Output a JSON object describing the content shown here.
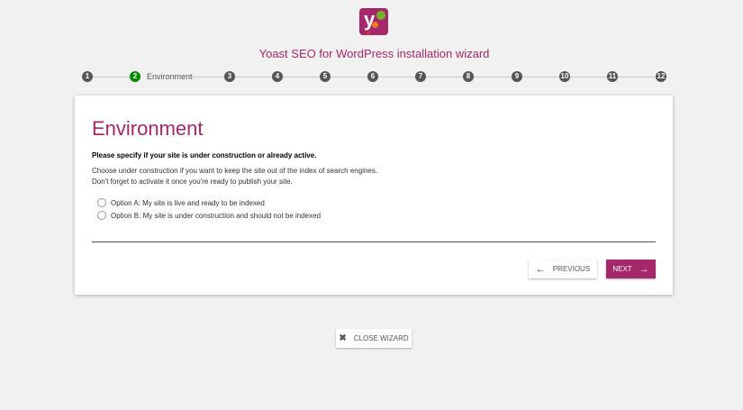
{
  "header": {
    "title": "Yoast SEO for WordPress installation wizard"
  },
  "steps": {
    "items": [
      "1",
      "2",
      "3",
      "4",
      "5",
      "6",
      "7",
      "8",
      "9",
      "10",
      "11",
      "12"
    ],
    "active_label": "Environment"
  },
  "card": {
    "title": "Environment",
    "question": "Please specify if your site is under construction or already active.",
    "desc1": "Choose under construction if you want to keep the site out of the index of search engines.",
    "desc2": "Don't forget to activate it once you're ready to publish your site.",
    "options": [
      "Option A: My site is live and ready to be indexed",
      "Option B: My site is under construction and should not be indexed"
    ],
    "previous": "PREVIOUS",
    "next": "NEXT"
  },
  "close": "CLOSE WIZARD",
  "colors": {
    "brand": "#a4286a",
    "active": "#008a00"
  }
}
